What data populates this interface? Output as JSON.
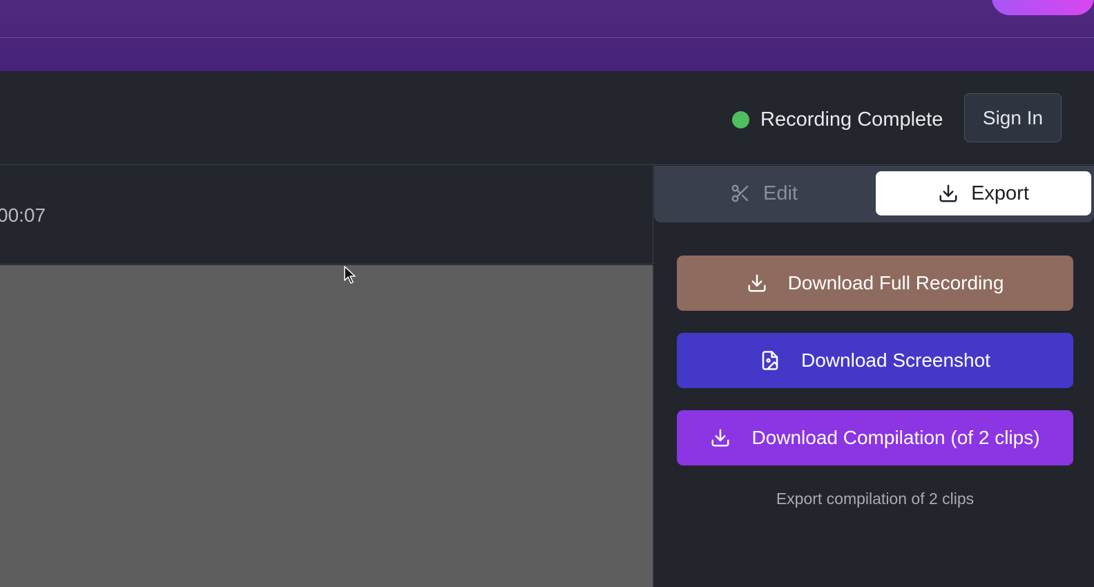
{
  "header": {
    "status_text": "Recording Complete",
    "status_color": "#4ebf5f",
    "sign_in_label": "Sign In"
  },
  "player": {
    "time_display": "00:07"
  },
  "tabs": [
    {
      "label": "Edit",
      "icon": "scissors-icon",
      "active": false
    },
    {
      "label": "Export",
      "icon": "download-icon",
      "active": true
    }
  ],
  "export": {
    "buttons": [
      {
        "label": "Download Full Recording",
        "icon": "download-icon",
        "color": "#8e6b5e"
      },
      {
        "label": "Download Screenshot",
        "icon": "image-file-icon",
        "color": "#4438c8"
      },
      {
        "label": "Download Compilation (of 2 clips)",
        "icon": "download-icon",
        "color": "#8b35e3"
      }
    ],
    "hint": "Export compilation of 2 clips"
  }
}
